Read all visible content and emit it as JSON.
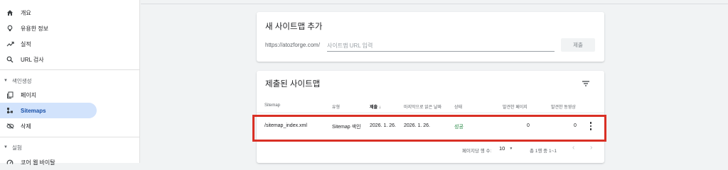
{
  "sidebar": {
    "items": [
      {
        "label": "개요",
        "icon": "home-icon"
      },
      {
        "label": "유용한 정보",
        "icon": "lightbulb-icon"
      },
      {
        "label": "실적",
        "icon": "trending-up-icon"
      },
      {
        "label": "URL 검사",
        "icon": "search-icon"
      }
    ],
    "index_section": {
      "label": "색인생성",
      "items": [
        {
          "label": "페이지",
          "icon": "pages-icon"
        },
        {
          "label": "Sitemaps",
          "icon": "sitemap-icon",
          "active": true
        },
        {
          "label": "삭제",
          "icon": "removal-icon"
        }
      ]
    },
    "experiment_section": {
      "label": "실험",
      "items": [
        {
          "label": "코어 웹 바이탈",
          "icon": "speed-icon"
        }
      ]
    }
  },
  "add_sitemap": {
    "title": "새 사이트맵 추가",
    "url_prefix": "https://atozforge.com/",
    "input_placeholder": "사이트맵 URL 입력",
    "input_value": "",
    "submit_label": "제출"
  },
  "submitted": {
    "title": "제출된 사이트맵",
    "columns": [
      "Sitemap",
      "유형",
      "제출 ↓",
      "마지막으로 읽은 날짜",
      "상태",
      "발견한 페이지",
      "발견한 동영상"
    ],
    "sorted_column": "제출",
    "rows": [
      {
        "sitemap": "/sitemap_index.xml",
        "type": "Sitemap 색인",
        "submitted": "2026. 1. 26.",
        "last_read": "2026. 1. 26.",
        "status": "성공",
        "pages": "0",
        "videos": "0"
      }
    ],
    "pagination": {
      "rows_per_page_label": "페이지당 행 수:",
      "rows_per_page": "10",
      "range": "총 1행 중 1~1"
    }
  },
  "colors": {
    "accent_active": "#d2e3fc",
    "status_success": "#188038",
    "highlight_border": "#d93025"
  }
}
